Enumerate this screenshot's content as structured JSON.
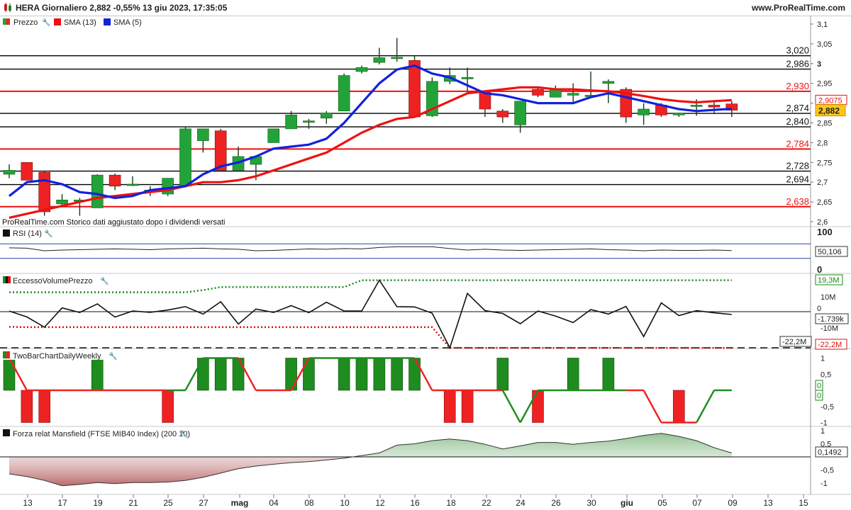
{
  "header": {
    "title": "HERA Giornaliero 2,882  -0,55% 13 giu 2023, 17:35:05",
    "brand": "www.ProRealTime.com"
  },
  "colors": {
    "up": "#22a33a",
    "down": "#ee2222",
    "sma13": "#ee1111",
    "sma5": "#1122dd",
    "support": "#ee1111",
    "level": "#000000",
    "mansfield_pos": "#1a7a1a",
    "mansfield_neg": "#8b1a1a"
  },
  "price_panel": {
    "legend": [
      "Prezzo",
      "SMA (13)",
      "SMA (5)"
    ],
    "note": "ProRealTime.com  Storico dati aggiustato dopo i dividendi versati",
    "current_price": "2,882",
    "sma13_value": "2,9075",
    "sma5_value": "2,8856"
  },
  "rsi_panel": {
    "label": "RSI (14)",
    "value": "50,106",
    "ticks": [
      "100",
      "0"
    ]
  },
  "volume_panel": {
    "label": "EccessoVolumePrezzo",
    "value_top": "19,3M",
    "value_mid": "-1.739k",
    "value_bottom": "-22,2M",
    "floor_label": "-22,2M",
    "ticks": [
      "10M",
      "0",
      "-10M"
    ]
  },
  "twobar_panel": {
    "label": "TwoBarChartDailyWeekly",
    "ticks": [
      "1",
      "0,5",
      "-0,5",
      "-1"
    ],
    "values": [
      "0",
      "0"
    ]
  },
  "mansfield_panel": {
    "label": "Forza relat Mansfield (FTSE MIB40 Index) (200 10)",
    "value": "0,1492",
    "ticks": [
      "1",
      "0,5",
      "-0,5",
      "-1"
    ]
  },
  "x_axis": {
    "labels": [
      "13",
      "17",
      "19",
      "21",
      "25",
      "27",
      "mag",
      "04",
      "08",
      "10",
      "12",
      "16",
      "18",
      "22",
      "24",
      "26",
      "30",
      "giu",
      "05",
      "07",
      "09",
      "13",
      "15"
    ]
  },
  "chart_data": {
    "type": "candlestick",
    "title": "HERA Giornaliero",
    "y_ticks": [
      "3,1",
      "3,05",
      "3",
      "2,95",
      "2,9",
      "2,85",
      "2,8",
      "2,75",
      "2,7",
      "2,65",
      "2,6"
    ],
    "ylim": [
      2.6,
      3.1
    ],
    "levels": [
      {
        "value": 3.02,
        "label": "3,020",
        "type": "resistance"
      },
      {
        "value": 2.986,
        "label": "2,986",
        "type": "resistance"
      },
      {
        "value": 2.93,
        "label": "2,930",
        "type": "key"
      },
      {
        "value": 2.874,
        "label": "2,874",
        "type": "resistance"
      },
      {
        "value": 2.84,
        "label": "2,840",
        "type": "resistance"
      },
      {
        "value": 2.784,
        "label": "2,784",
        "type": "key"
      },
      {
        "value": 2.728,
        "label": "2,728",
        "type": "resistance"
      },
      {
        "value": 2.694,
        "label": "2,694",
        "type": "resistance"
      },
      {
        "value": 2.638,
        "label": "2,638",
        "type": "key"
      }
    ],
    "candles": [
      {
        "o": 2.72,
        "h": 2.745,
        "l": 2.71,
        "c": 2.73
      },
      {
        "o": 2.75,
        "h": 2.75,
        "l": 2.705,
        "c": 2.705
      },
      {
        "o": 2.725,
        "h": 2.728,
        "l": 2.615,
        "c": 2.625
      },
      {
        "o": 2.645,
        "h": 2.67,
        "l": 2.64,
        "c": 2.655
      },
      {
        "o": 2.655,
        "h": 2.66,
        "l": 2.615,
        "c": 2.655
      },
      {
        "o": 2.635,
        "h": 2.72,
        "l": 2.635,
        "c": 2.718
      },
      {
        "o": 2.718,
        "h": 2.722,
        "l": 2.68,
        "c": 2.69
      },
      {
        "o": 2.695,
        "h": 2.715,
        "l": 2.69,
        "c": 2.695
      },
      {
        "o": 2.68,
        "h": 2.69,
        "l": 2.665,
        "c": 2.68
      },
      {
        "o": 2.67,
        "h": 2.71,
        "l": 2.665,
        "c": 2.71
      },
      {
        "o": 2.69,
        "h": 2.84,
        "l": 2.69,
        "c": 2.835
      },
      {
        "o": 2.805,
        "h": 2.835,
        "l": 2.775,
        "c": 2.835
      },
      {
        "o": 2.83,
        "h": 2.835,
        "l": 2.73,
        "c": 2.73
      },
      {
        "o": 2.73,
        "h": 2.79,
        "l": 2.73,
        "c": 2.765
      },
      {
        "o": 2.745,
        "h": 2.76,
        "l": 2.705,
        "c": 2.765
      },
      {
        "o": 2.8,
        "h": 2.835,
        "l": 2.8,
        "c": 2.835
      },
      {
        "o": 2.835,
        "h": 2.88,
        "l": 2.835,
        "c": 2.87
      },
      {
        "o": 2.855,
        "h": 2.86,
        "l": 2.835,
        "c": 2.855
      },
      {
        "o": 2.862,
        "h": 2.88,
        "l": 2.848,
        "c": 2.875
      },
      {
        "o": 2.88,
        "h": 2.975,
        "l": 2.88,
        "c": 2.97
      },
      {
        "o": 2.98,
        "h": 2.995,
        "l": 2.975,
        "c": 2.99
      },
      {
        "o": 3.003,
        "h": 3.04,
        "l": 2.998,
        "c": 3.015
      },
      {
        "o": 3.015,
        "h": 3.065,
        "l": 3.005,
        "c": 3.016
      },
      {
        "o": 3.008,
        "h": 3.02,
        "l": 2.865,
        "c": 2.865
      },
      {
        "o": 2.868,
        "h": 2.965,
        "l": 2.865,
        "c": 2.955
      },
      {
        "o": 2.955,
        "h": 2.99,
        "l": 2.948,
        "c": 2.97
      },
      {
        "o": 2.965,
        "h": 2.99,
        "l": 2.93,
        "c": 2.965
      },
      {
        "o": 2.93,
        "h": 2.93,
        "l": 2.865,
        "c": 2.885
      },
      {
        "o": 2.88,
        "h": 2.885,
        "l": 2.85,
        "c": 2.865
      },
      {
        "o": 2.845,
        "h": 2.905,
        "l": 2.825,
        "c": 2.905
      },
      {
        "o": 2.935,
        "h": 2.94,
        "l": 2.915,
        "c": 2.92
      },
      {
        "o": 2.915,
        "h": 2.945,
        "l": 2.915,
        "c": 2.935
      },
      {
        "o": 2.92,
        "h": 2.95,
        "l": 2.9,
        "c": 2.925
      },
      {
        "o": 2.92,
        "h": 2.98,
        "l": 2.915,
        "c": 2.92
      },
      {
        "o": 2.95,
        "h": 2.96,
        "l": 2.9,
        "c": 2.955
      },
      {
        "o": 2.935,
        "h": 2.94,
        "l": 2.85,
        "c": 2.865
      },
      {
        "o": 2.87,
        "h": 2.9,
        "l": 2.845,
        "c": 2.885
      },
      {
        "o": 2.895,
        "h": 2.9,
        "l": 2.865,
        "c": 2.87
      },
      {
        "o": 2.87,
        "h": 2.875,
        "l": 2.865,
        "c": 2.875
      },
      {
        "o": 2.895,
        "h": 2.91,
        "l": 2.868,
        "c": 2.895
      },
      {
        "o": 2.895,
        "h": 2.905,
        "l": 2.872,
        "c": 2.89
      },
      {
        "o": 2.898,
        "h": 2.905,
        "l": 2.865,
        "c": 2.882
      }
    ],
    "sma5": [
      2.665,
      2.7,
      2.705,
      2.695,
      2.675,
      2.67,
      2.66,
      2.665,
      2.68,
      2.685,
      2.69,
      2.72,
      2.74,
      2.75,
      2.765,
      2.785,
      2.79,
      2.795,
      2.81,
      2.85,
      2.9,
      2.95,
      2.985,
      2.995,
      2.975,
      2.965,
      2.945,
      2.925,
      2.92,
      2.91,
      2.9,
      2.9,
      2.9,
      2.915,
      2.925,
      2.915,
      2.905,
      2.895,
      2.885,
      2.88,
      2.883,
      2.8856
    ],
    "sma13": [
      2.61,
      2.62,
      2.63,
      2.64,
      2.65,
      2.66,
      2.665,
      2.67,
      2.675,
      2.68,
      2.69,
      2.7,
      2.7,
      2.705,
      2.715,
      2.73,
      2.745,
      2.76,
      2.775,
      2.8,
      2.825,
      2.845,
      2.86,
      2.865,
      2.885,
      2.905,
      2.925,
      2.93,
      2.935,
      2.94,
      2.94,
      2.935,
      2.935,
      2.932,
      2.93,
      2.925,
      2.918,
      2.91,
      2.905,
      2.902,
      2.905,
      2.9075
    ],
    "rsi": [
      59,
      58,
      51,
      53,
      54,
      55,
      56,
      55,
      54,
      56,
      57,
      58,
      56,
      55,
      51,
      52,
      54,
      56,
      55,
      57,
      56,
      60,
      62,
      62,
      62,
      57,
      53,
      55,
      53,
      52,
      53,
      54,
      55,
      56,
      54,
      53,
      51,
      53,
      52,
      52,
      53,
      51.5
    ],
    "excess_volume": [
      0.4,
      -3.2,
      -9.5,
      2.3,
      -0.5,
      4.8,
      -3.3,
      0.4,
      -0.4,
      1.0,
      3.1,
      -1.5,
      6.1,
      -7.6,
      1.6,
      -0.5,
      3.7,
      -0.6,
      5.8,
      0.4,
      0.4,
      19.3,
      3.1,
      2.9,
      -0.9,
      -22.2,
      11.2,
      0.6,
      -1.1,
      -7.4,
      0.4,
      -2.7,
      -6.7,
      1.3,
      -1.5,
      3.2,
      -15.3,
      5.4,
      -2.4,
      0.6,
      -0.7,
      -1.739
    ],
    "excess_volume_upper": [
      11.9,
      11.9,
      11.9,
      11.9,
      11.9,
      11.9,
      11.9,
      11.9,
      11.9,
      11.9,
      11.9,
      13.2,
      15.1,
      15.1,
      15.1,
      15.1,
      15.1,
      15.1,
      15.1,
      15.1,
      19.3,
      19.3,
      19.3,
      19.3,
      19.3,
      19.3,
      19.3,
      19.3,
      19.3,
      19.3,
      19.3,
      19.3,
      19.3,
      19.3,
      19.3,
      19.3,
      19.3,
      19.3,
      19.3,
      19.3,
      19.3,
      19.3
    ],
    "excess_volume_lower": [
      -9.3,
      -9.5,
      -9.5,
      -9.5,
      -9.5,
      -9.5,
      -9.5,
      -9.5,
      -9.5,
      -9.5,
      -9.5,
      -9.5,
      -9.5,
      -9.5,
      -9.5,
      -9.5,
      -9.5,
      -9.5,
      -9.5,
      -9.5,
      -9.5,
      -9.5,
      -9.5,
      -9.5,
      -9.5,
      -22.2,
      -22.2,
      -22.2,
      -22.2,
      -22.2,
      -22.2,
      -22.2,
      -22.2,
      -22.2,
      -22.2,
      -22.2,
      -22.2,
      -22.2,
      -22.2,
      -22.2,
      -22.2,
      -22.2
    ],
    "twobar_bars": [
      1,
      -1,
      -1,
      0,
      0,
      1,
      0,
      0,
      0,
      -1,
      0,
      1,
      1,
      1,
      0,
      0,
      1,
      1,
      0,
      1,
      1,
      1,
      1,
      1,
      0,
      -1,
      -1,
      0,
      1,
      0,
      -1,
      0,
      1,
      0,
      1,
      0,
      0,
      0,
      -1,
      0,
      0,
      0
    ],
    "twobar_line": [
      1,
      0,
      0,
      0,
      0,
      0,
      0,
      0,
      0,
      0,
      0,
      1,
      1,
      1,
      0,
      0,
      0,
      1,
      1,
      1,
      1,
      1,
      1,
      1,
      0,
      0,
      0,
      0,
      0,
      -1,
      0,
      0,
      0,
      0,
      0,
      0,
      0,
      -1,
      -1,
      -1,
      0,
      0
    ],
    "twobar_line_color": [
      "red",
      "red",
      "red",
      "red",
      "red",
      "red",
      "red",
      "red",
      "red",
      "red",
      "green",
      "green",
      "green",
      "green",
      "red",
      "red",
      "red",
      "red",
      "green",
      "green",
      "green",
      "green",
      "green",
      "green",
      "red",
      "red",
      "red",
      "red",
      "red",
      "green",
      "green",
      "green",
      "green",
      "green",
      "green",
      "green",
      "red",
      "red",
      "red",
      "red",
      "green",
      "green"
    ],
    "mansfield": [
      -0.65,
      -0.75,
      -0.9,
      -1.1,
      -1.05,
      -0.98,
      -1.02,
      -0.98,
      -0.98,
      -0.96,
      -0.9,
      -0.78,
      -0.62,
      -0.45,
      -0.35,
      -0.28,
      -0.22,
      -0.18,
      -0.12,
      -0.05,
      0.05,
      0.15,
      0.45,
      0.5,
      0.62,
      0.68,
      0.62,
      0.48,
      0.3,
      0.42,
      0.55,
      0.55,
      0.48,
      0.55,
      0.6,
      0.7,
      0.82,
      0.9,
      0.78,
      0.62,
      0.35,
      0.1492
    ]
  }
}
